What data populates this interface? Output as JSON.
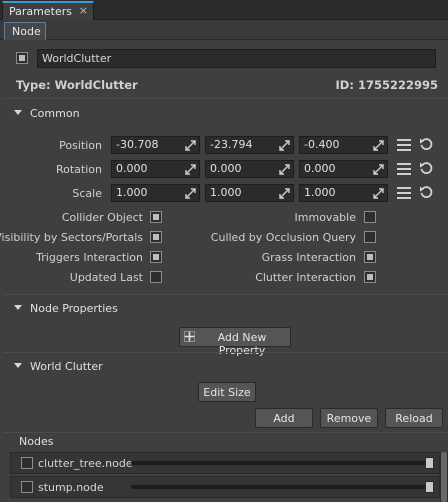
{
  "panel": {
    "tab_title": "Parameters",
    "tab_close": "×",
    "subtab": "Node"
  },
  "node": {
    "enabled": true,
    "name": "WorldClutter",
    "type_label": "Type:",
    "type_value": "WorldClutter",
    "id_label": "ID:",
    "id_value": "1755222995"
  },
  "common": {
    "title": "Common",
    "rows": [
      {
        "label": "Position",
        "values": [
          "-30.708",
          "-23.794",
          "-0.400"
        ]
      },
      {
        "label": "Rotation",
        "values": [
          "0.000",
          "0.000",
          "0.000"
        ]
      },
      {
        "label": "Scale",
        "values": [
          "1.000",
          "1.000",
          "1.000"
        ]
      }
    ],
    "options_left": [
      {
        "label": "Collider Object",
        "checked": true
      },
      {
        "label": "Visibility by Sectors/Portals",
        "checked": true
      },
      {
        "label": "Triggers Interaction",
        "checked": true
      },
      {
        "label": "Updated Last",
        "checked": false
      }
    ],
    "options_right": [
      {
        "label": "Immovable",
        "checked": false
      },
      {
        "label": "Culled by Occlusion Query",
        "checked": false
      },
      {
        "label": "Grass Interaction",
        "checked": true
      },
      {
        "label": "Clutter Interaction",
        "checked": true
      }
    ]
  },
  "node_properties": {
    "title": "Node Properties",
    "add_button": "Add New Property"
  },
  "world_clutter": {
    "title": "World Clutter",
    "edit_size": "Edit Size",
    "add": "Add",
    "remove": "Remove",
    "reload": "Reload",
    "nodes_title": "Nodes",
    "nodes": [
      {
        "name": "clutter_tree.node",
        "checked": false,
        "value": 1.0
      },
      {
        "name": "stump.node",
        "checked": false,
        "value": 1.0
      }
    ]
  },
  "colors": {
    "background": "#3f3f3f",
    "field": "#2b2b2b",
    "accent": "#3a9bd9"
  }
}
